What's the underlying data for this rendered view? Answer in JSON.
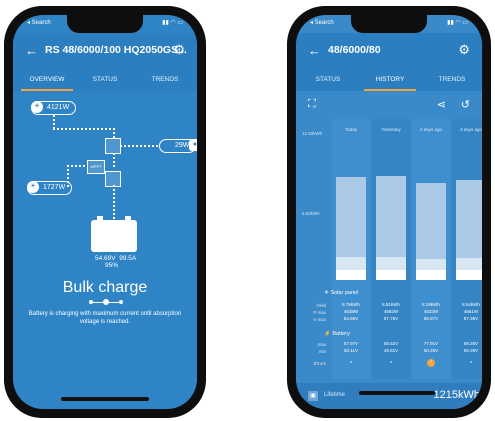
{
  "left": {
    "status": {
      "carrier": "◂ Search"
    },
    "title": "RS 48/6000/100 HQ2050GS...",
    "tabs": [
      "OVERVIEW",
      "STATUS",
      "TRENDS"
    ],
    "solar_top": "4121W",
    "solar_bottom": "1727W",
    "load": "29W",
    "battery_voltage": "54.69V",
    "battery_current": "99.5A",
    "battery_soc": "95%",
    "state": "Bulk charge",
    "message": "Battery is charging with maximum current until absorption voltage is reached."
  },
  "right": {
    "status": {
      "carrier": "◂ Search"
    },
    "title": "48/6000/80",
    "tabs": [
      "STATUS",
      "HISTORY",
      "TRENDS"
    ],
    "day_labels": [
      "Today",
      "Yesterday",
      "2 days ago",
      "3 days ago"
    ],
    "y_top": "12.50kWh",
    "y_mid": "6.83kWh",
    "solar_header": "Solar panel",
    "row_labels": [
      "Yield",
      "P max",
      "V max"
    ],
    "solar_values": [
      [
        "8.76kWh",
        "4638W",
        "84.96V"
      ],
      [
        "8.81kWh",
        "4682W",
        "87.78V"
      ],
      [
        "8.29kWh",
        "4633W",
        "86.87V"
      ],
      [
        "8.54kWh",
        "4661W",
        "87.39V"
      ]
    ],
    "battery_header": "Battery",
    "battery_labels": [
      "max",
      "min"
    ],
    "battery_values": [
      [
        "57.97V",
        "50.11V"
      ],
      [
        "58.52V",
        "49.81V"
      ],
      [
        "77.91V",
        "50.29V"
      ],
      [
        "58.26V",
        "50.39V"
      ]
    ],
    "errors_label": "Errors",
    "errors": [
      "-",
      "-",
      "!",
      "-"
    ],
    "lifetime_label": "Lifetime",
    "lifetime_value": "1215kWh",
    "bars": [
      {
        "total": 8.76,
        "soc": 0.82
      },
      {
        "total": 8.81,
        "soc": 0.8
      },
      {
        "total": 8.29,
        "soc": 0.8
      },
      {
        "total": 8.54,
        "soc": 0.8
      }
    ]
  }
}
